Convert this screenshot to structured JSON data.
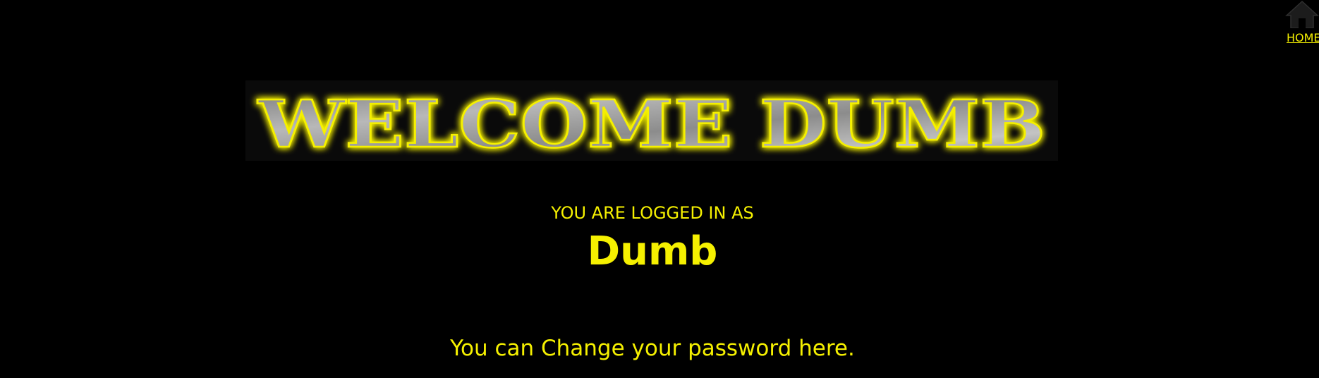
{
  "nav": {
    "home_label": "HOME",
    "home_icon": "home-icon"
  },
  "banner": {
    "text": "WELCOME DUMB"
  },
  "session": {
    "logged_in_label": "YOU ARE LOGGED IN AS",
    "username": "Dumb"
  },
  "links": {
    "change_password": "You can Change your password here."
  },
  "colors": {
    "background": "#000000",
    "accent": "#f5f000",
    "banner_metal": "#a0a0a0"
  }
}
